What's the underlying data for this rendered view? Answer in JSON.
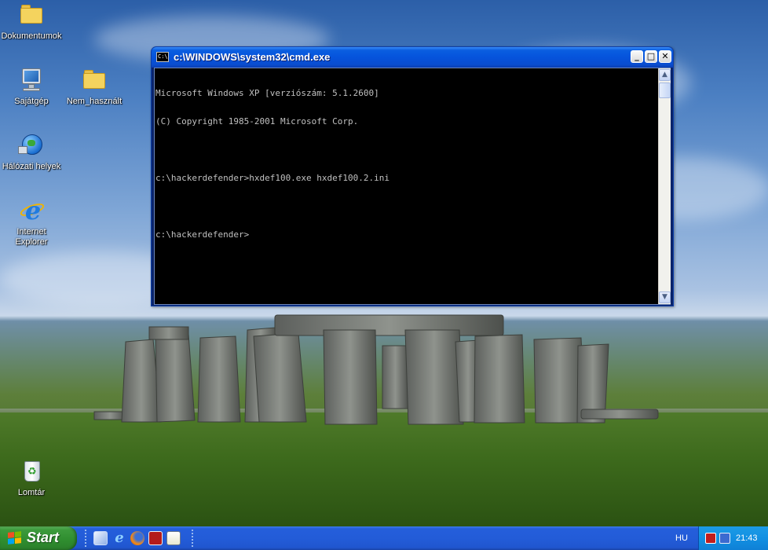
{
  "desktop": {
    "icons": [
      {
        "label": "Dokumentumok",
        "icon": "documents-folder-icon"
      },
      {
        "label": "Sajátgép",
        "icon": "my-computer-icon"
      },
      {
        "label": "Nem_használt",
        "icon": "folder-icon"
      },
      {
        "label": "Hálózati helyek",
        "icon": "network-places-icon"
      },
      {
        "label": "Internet Explorer",
        "icon": "internet-explorer-icon"
      },
      {
        "label": "Lomtár",
        "icon": "recycle-bin-icon"
      }
    ]
  },
  "cmd": {
    "title": "c:\\WINDOWS\\system32\\cmd.exe",
    "icon_text": "C:\\",
    "buttons": {
      "minimize": "_",
      "maximize": "□",
      "close": "✕"
    },
    "lines": [
      "Microsoft Windows XP [verziószám: 5.1.2600]",
      "(C) Copyright 1985-2001 Microsoft Corp.",
      "",
      "c:\\hackerdefender>hxdef100.exe hxdef100.2.ini",
      "",
      "c:\\hackerdefender>"
    ],
    "scroll_up": "▲",
    "scroll_down": "▼"
  },
  "taskbar": {
    "start_label": "Start",
    "quick_launch": [
      "show-desktop-icon",
      "internet-explorer-icon",
      "firefox-icon",
      "save-icon",
      "notepad-icon"
    ],
    "language": "HU",
    "clock": "21:43"
  },
  "colors": {
    "console_bg": "#000000",
    "console_text": "#c0c0c0",
    "titlebar": "#0553dc",
    "taskbar": "#245edb",
    "start_button": "#3c9a3c"
  }
}
